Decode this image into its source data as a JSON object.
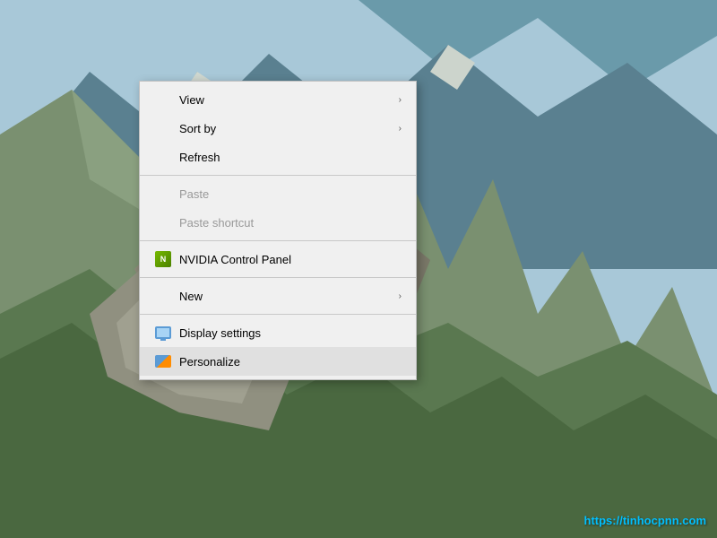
{
  "desktop": {
    "background": "mountain landscape"
  },
  "contextMenu": {
    "items": [
      {
        "id": "view",
        "label": "View",
        "hasSubmenu": true,
        "disabled": false,
        "hasIcon": false,
        "highlighted": false
      },
      {
        "id": "sort-by",
        "label": "Sort by",
        "hasSubmenu": true,
        "disabled": false,
        "hasIcon": false,
        "highlighted": false
      },
      {
        "id": "refresh",
        "label": "Refresh",
        "hasSubmenu": false,
        "disabled": false,
        "hasIcon": false,
        "highlighted": false
      },
      {
        "id": "sep1",
        "type": "separator"
      },
      {
        "id": "paste",
        "label": "Paste",
        "hasSubmenu": false,
        "disabled": true,
        "hasIcon": false,
        "highlighted": false
      },
      {
        "id": "paste-shortcut",
        "label": "Paste shortcut",
        "hasSubmenu": false,
        "disabled": true,
        "hasIcon": false,
        "highlighted": false
      },
      {
        "id": "sep2",
        "type": "separator"
      },
      {
        "id": "nvidia",
        "label": "NVIDIA Control Panel",
        "hasSubmenu": false,
        "disabled": false,
        "hasIcon": true,
        "iconType": "nvidia",
        "highlighted": false
      },
      {
        "id": "sep3",
        "type": "separator"
      },
      {
        "id": "new",
        "label": "New",
        "hasSubmenu": true,
        "disabled": false,
        "hasIcon": false,
        "highlighted": false
      },
      {
        "id": "sep4",
        "type": "separator"
      },
      {
        "id": "display",
        "label": "Display settings",
        "hasSubmenu": false,
        "disabled": false,
        "hasIcon": true,
        "iconType": "display",
        "highlighted": false
      },
      {
        "id": "personalize",
        "label": "Personalize",
        "hasSubmenu": false,
        "disabled": false,
        "hasIcon": true,
        "iconType": "personalize",
        "highlighted": true
      }
    ]
  },
  "watermark": {
    "text": "https://tinhocpnn.com"
  }
}
